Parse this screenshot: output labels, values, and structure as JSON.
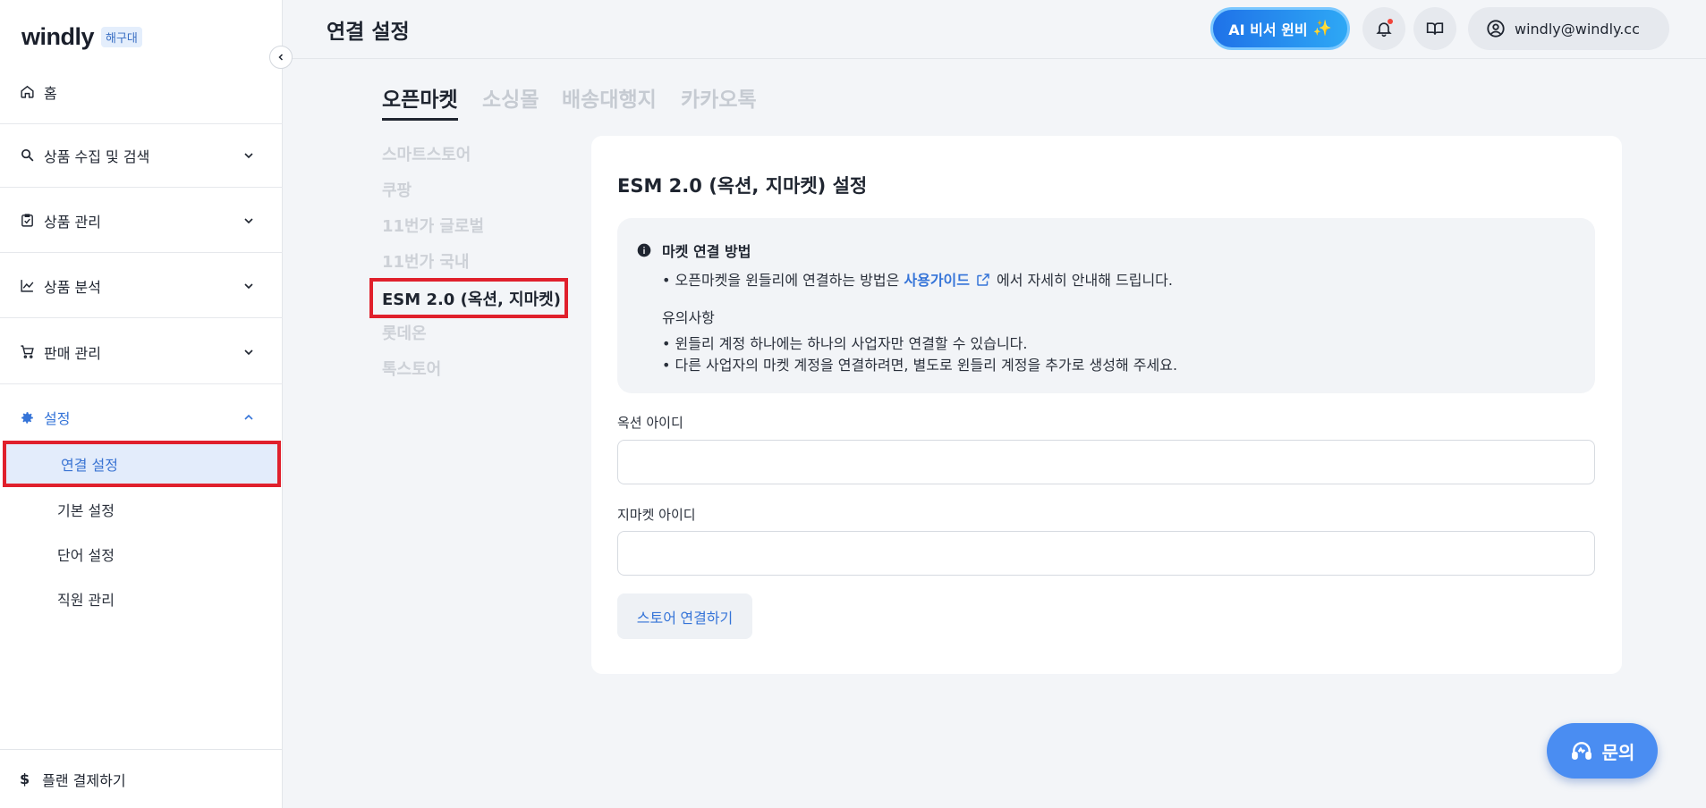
{
  "brand": {
    "logo_text": "windly",
    "badge": "해구대"
  },
  "sidebar": {
    "items": [
      {
        "label": "홈",
        "icon": "home-icon"
      },
      {
        "label": "상품 수집 및 검색",
        "icon": "search-icon"
      },
      {
        "label": "상품 관리",
        "icon": "clipboard-check-icon"
      },
      {
        "label": "상품 분석",
        "icon": "chart-line-icon"
      },
      {
        "label": "판매 관리",
        "icon": "cart-icon"
      },
      {
        "label": "설정",
        "icon": "gear-icon"
      }
    ],
    "sub_items": [
      "연결 설정",
      "기본 설정",
      "단어 설정",
      "직원 관리"
    ],
    "plan_label": "플랜 결제하기",
    "plan_icon": "$"
  },
  "header": {
    "title": "연결 설정",
    "ai_button": "AI 비서 윈비",
    "ai_spark": "✨",
    "user_email": "windly@windly.cc"
  },
  "tabs": [
    "오픈마켓",
    "소싱몰",
    "배송대행지",
    "카카오톡"
  ],
  "markets": [
    "스마트스토어",
    "쿠팡",
    "11번가 글로벌",
    "11번가 국내",
    "ESM 2.0 (옥션, 지마켓)",
    "롯데온",
    "톡스토어"
  ],
  "card": {
    "title": "ESM 2.0 (옥션, 지마켓) 설정",
    "info": {
      "heading": "마켓 연결 방법",
      "line1_prefix": "• 오픈마켓을 윈들리에 연결하는 방법은 ",
      "line1_link": "사용가이드",
      "line1_suffix": "에서 자세히 안내해 드립니다.",
      "note_title": "유의사항",
      "note1": "• 윈들리 계정 하나에는 하나의 사업자만 연결할 수 있습니다.",
      "note2": "• 다른 사업자의 마켓 계정을 연결하려면, 별도로 윈들리 계정을 추가로 생성해 주세요."
    },
    "auction_label": "옥션 아이디",
    "auction_value": "",
    "gmarket_label": "지마켓 아이디",
    "gmarket_value": "",
    "connect_button": "스토어 연결하기"
  },
  "inquiry_button": "문의",
  "colors": {
    "accent": "#3574d8",
    "highlight": "#e0202c"
  }
}
